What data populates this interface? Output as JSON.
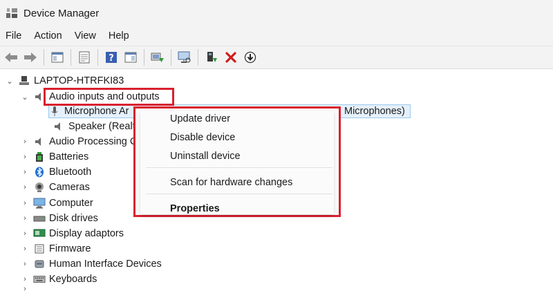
{
  "window": {
    "title": "Device Manager"
  },
  "menubar": {
    "items": [
      {
        "label": "File"
      },
      {
        "label": "Action"
      },
      {
        "label": "View"
      },
      {
        "label": "Help"
      }
    ]
  },
  "toolbar": {
    "buttons": [
      {
        "icon": "back-arrow-icon"
      },
      {
        "icon": "forward-arrow-icon"
      },
      {
        "icon": "show-hide-console-tree-icon"
      },
      {
        "icon": "properties-icon"
      },
      {
        "icon": "help-icon"
      },
      {
        "icon": "action-pane-icon"
      },
      {
        "icon": "update-driver-icon"
      },
      {
        "icon": "scan-hardware-icon"
      },
      {
        "icon": "add-driver-icon"
      },
      {
        "icon": "uninstall-x-icon"
      },
      {
        "icon": "download-icon"
      }
    ]
  },
  "tree": {
    "root": "LAPTOP-HTRFKI83",
    "audio_category": "Audio inputs and outputs",
    "audio_children": [
      {
        "label": "Microphone Ar",
        "suffix": "Microphones)"
      },
      {
        "label": "Speaker (Realte"
      }
    ],
    "categories": [
      {
        "label": "Audio Processing C",
        "icon": "audio-processing-icon"
      },
      {
        "label": "Batteries",
        "icon": "battery-icon"
      },
      {
        "label": "Bluetooth",
        "icon": "bluetooth-icon"
      },
      {
        "label": "Cameras",
        "icon": "camera-icon"
      },
      {
        "label": "Computer",
        "icon": "computer-icon"
      },
      {
        "label": "Disk drives",
        "icon": "disk-drive-icon"
      },
      {
        "label": "Display adaptors",
        "icon": "display-adapter-icon"
      },
      {
        "label": "Firmware",
        "icon": "firmware-icon"
      },
      {
        "label": "Human Interface Devices",
        "icon": "hid-icon"
      },
      {
        "label": "Keyboards",
        "icon": "keyboard-icon"
      }
    ]
  },
  "context_menu": {
    "items": [
      {
        "label": "Update driver"
      },
      {
        "label": "Disable device"
      },
      {
        "label": "Uninstall device"
      },
      {
        "label": "Scan for hardware changes"
      },
      {
        "label": "Properties"
      }
    ]
  },
  "colors": {
    "highlight": "#d9202e",
    "selection": "#e5f0fb",
    "chrome": "#f3f3f3"
  }
}
